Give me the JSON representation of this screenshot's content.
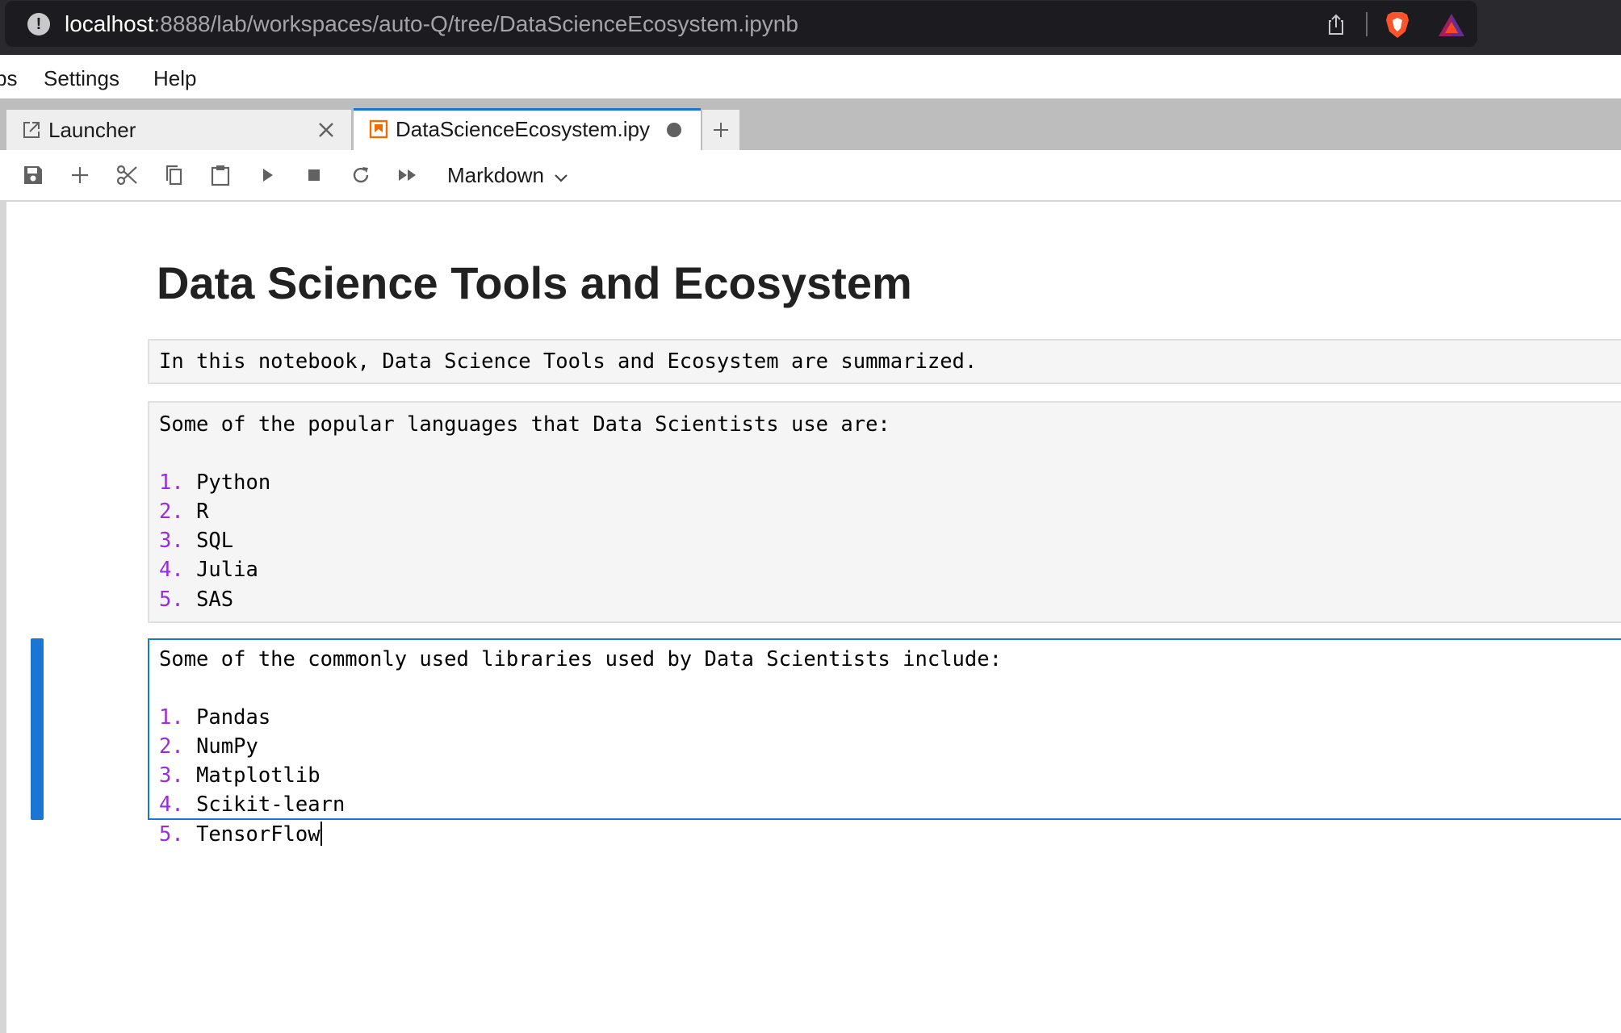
{
  "browser": {
    "url_host": "localhost",
    "url_rest": ":8888/lab/workspaces/auto-Q/tree/DataScienceEcosystem.ipynb"
  },
  "menu": {
    "items": [
      {
        "label": "ps"
      },
      {
        "label": "Settings"
      },
      {
        "label": "Help"
      }
    ]
  },
  "tabs": [
    {
      "label": "Launcher",
      "icon": "launcher-icon",
      "active": false
    },
    {
      "label": "DataScienceEcosystem.ipy",
      "icon": "notebook-icon",
      "active": true,
      "unsaved": true
    }
  ],
  "toolbar": {
    "buttons": [
      "save-icon",
      "add-icon",
      "cut-icon",
      "copy-icon",
      "paste-icon",
      "run-icon",
      "stop-icon",
      "restart-icon",
      "run-all-icon"
    ],
    "cell_type": "Markdown"
  },
  "notebook": {
    "title": "Data Science Tools and Ecosystem",
    "cells": [
      {
        "lines": [
          "In this notebook, Data Science Tools and Ecosystem are summarized."
        ]
      },
      {
        "intro": "Some of the popular languages that Data Scientists use are:",
        "items": [
          {
            "num": "1.",
            "text": "Python"
          },
          {
            "num": "2.",
            "text": "R"
          },
          {
            "num": "3.",
            "text": "SQL"
          },
          {
            "num": "4.",
            "text": "Julia"
          },
          {
            "num": "5.",
            "text": "SAS"
          }
        ]
      },
      {
        "intro": "Some of the commonly used libraries used by Data Scientists include:",
        "items": [
          {
            "num": "1.",
            "text": "Pandas"
          },
          {
            "num": "2.",
            "text": "NumPy"
          },
          {
            "num": "3.",
            "text": "Matplotlib"
          },
          {
            "num": "4.",
            "text": "Scikit-learn"
          },
          {
            "num": "5.",
            "text": "TensorFlow"
          }
        ]
      }
    ]
  },
  "colors": {
    "accent": "#1976d2",
    "list_number": "#9b2cdb",
    "brave": "#fb542b"
  }
}
